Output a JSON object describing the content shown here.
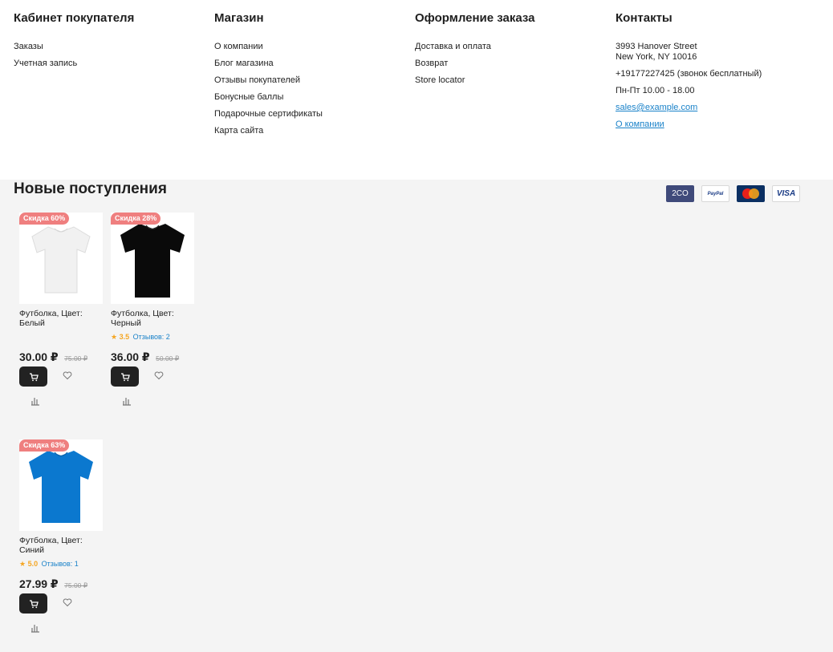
{
  "footer": {
    "columns": [
      {
        "title": "Кабинет покупателя",
        "items": [
          "Заказы",
          "Учетная запись"
        ]
      },
      {
        "title": "Магазин",
        "items": [
          "О компании",
          "Блог магазина",
          "Отзывы покупателей",
          "Бонусные баллы",
          "Подарочные сертификаты",
          "Карта сайта"
        ]
      },
      {
        "title": "Оформление заказа",
        "items": [
          "Доставка и оплата",
          "Возврат",
          "Store locator"
        ]
      }
    ],
    "contacts": {
      "title": "Контакты",
      "address_line1": "3993 Hanover Street",
      "address_line2": "New York, NY 10016",
      "phone": "+19177227425 (звонок бесплатный)",
      "hours": "Пн-Пт 10.00 - 18.00",
      "email": "sales@example.com",
      "about_link": "О компании"
    }
  },
  "section": {
    "title": "Новые поступления"
  },
  "payments": [
    {
      "name": "2co-icon",
      "label": "2CO"
    },
    {
      "name": "paypal-icon",
      "label": "PayPal"
    },
    {
      "name": "mastercard-icon",
      "label": "MasterCard"
    },
    {
      "name": "visa-icon",
      "label": "VISA"
    }
  ],
  "products": [
    {
      "badge": "Скидка 60%",
      "name_line1": "Футболка, Цвет:",
      "name_line2": "Белый",
      "price": "30.00 ₽",
      "old_price": "75.00 ₽",
      "color": "#f2f2f2",
      "shirt": "white"
    },
    {
      "badge": "Скидка 28%",
      "name_line1": "Футболка, Цвет:",
      "name_line2": "Черный",
      "rating": "3.5",
      "reviews": "Отзывов: 2",
      "price": "36.00 ₽",
      "old_price": "50.00 ₽",
      "color": "#111111",
      "shirt": "black"
    },
    {
      "badge": "Скидка 63%",
      "name_line1": "Футболка, Цвет:",
      "name_line2": "Синий",
      "rating": "5.0",
      "reviews": "Отзывов: 1",
      "price": "27.99 ₽",
      "old_price": "75.00 ₽",
      "color": "#1177cc",
      "shirt": "blue"
    }
  ]
}
